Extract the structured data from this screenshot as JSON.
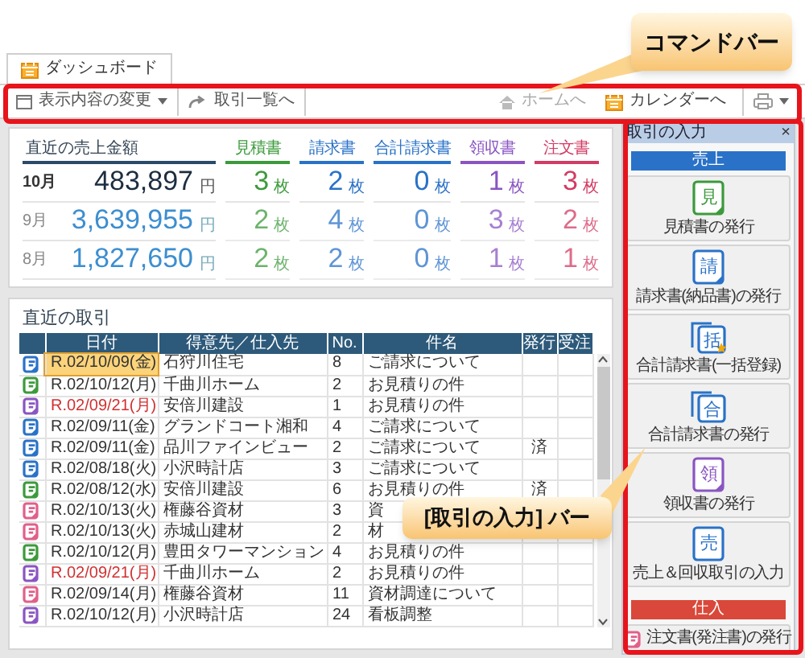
{
  "tab": {
    "label": "ダッシュボード",
    "selected": true
  },
  "command_bar": {
    "left": [
      {
        "label": "表示内容の変更",
        "kind": "view"
      },
      {
        "label": "取引一覧へ",
        "kind": "list"
      }
    ],
    "right": [
      {
        "label": "ホームへ",
        "kind": "home",
        "disabled": true
      },
      {
        "label": "カレンダーへ",
        "kind": "calendar",
        "disabled": false
      },
      {
        "kind": "print"
      }
    ]
  },
  "sales_summary": {
    "title": "直近の売上金額",
    "columns": [
      {
        "label": "見積書",
        "color": "#3c9a3c"
      },
      {
        "label": "請求書",
        "color": "#2a72c8"
      },
      {
        "label": "合計請求書",
        "color": "#2a72c8"
      },
      {
        "label": "領収書",
        "color": "#8a55c2"
      },
      {
        "label": "注文書",
        "color": "#d23c64"
      }
    ],
    "rows": [
      {
        "month": "10月",
        "amount": "483,897",
        "unit": "円",
        "current": true,
        "counts": [
          {
            "value": "3",
            "unit": "枚"
          },
          {
            "value": "2",
            "unit": "枚"
          },
          {
            "value": "0",
            "unit": "枚"
          },
          {
            "value": "1",
            "unit": "枚"
          },
          {
            "value": "3",
            "unit": "枚"
          }
        ]
      },
      {
        "month": "9月",
        "amount": "3,639,955",
        "unit": "円",
        "current": false,
        "counts": [
          {
            "value": "2",
            "unit": "枚"
          },
          {
            "value": "4",
            "unit": "枚"
          },
          {
            "value": "0",
            "unit": "枚"
          },
          {
            "value": "3",
            "unit": "枚"
          },
          {
            "value": "2",
            "unit": "枚"
          }
        ]
      },
      {
        "month": "8月",
        "amount": "1,827,650",
        "unit": "円",
        "current": false,
        "counts": [
          {
            "value": "2",
            "unit": "枚"
          },
          {
            "value": "2",
            "unit": "枚"
          },
          {
            "value": "0",
            "unit": "枚"
          },
          {
            "value": "1",
            "unit": "枚"
          },
          {
            "value": "1",
            "unit": "枚"
          }
        ]
      }
    ]
  },
  "transactions": {
    "title": "直近の取引",
    "columns": [
      "日付",
      "得意先／仕入先",
      "No.",
      "件名",
      "発行",
      "受注"
    ],
    "rows": [
      {
        "kind": "invoice",
        "date": "R.02/10/09(金)",
        "date_alert": false,
        "selected": true,
        "customer": "石狩川住宅",
        "no": "8",
        "subject": "ご請求について"
      },
      {
        "kind": "estimate",
        "date": "R.02/10/12(月)",
        "date_alert": false,
        "selected": false,
        "customer": "千曲川ホーム",
        "no": "2",
        "subject": "お見積りの件"
      },
      {
        "kind": "receipt",
        "date": "R.02/09/21(月)",
        "date_alert": true,
        "selected": false,
        "customer": "安倍川建設",
        "no": "1",
        "subject": "お見積りの件"
      },
      {
        "kind": "invoice",
        "date": "R.02/09/11(金)",
        "date_alert": false,
        "selected": false,
        "customer": "グランドコート湘和",
        "no": "4",
        "subject": "ご請求について"
      },
      {
        "kind": "invoice",
        "date": "R.02/09/11(金)",
        "date_alert": false,
        "selected": false,
        "customer": "品川ファインビュー",
        "no": "2",
        "subject": "ご請求について",
        "issued": "済"
      },
      {
        "kind": "invoice",
        "date": "R.02/08/18(火)",
        "date_alert": false,
        "selected": false,
        "customer": "小沢時計店",
        "no": "3",
        "subject": "ご請求について"
      },
      {
        "kind": "estimate",
        "date": "R.02/08/12(水)",
        "date_alert": false,
        "selected": false,
        "customer": "安倍川建設",
        "no": "6",
        "subject": "お見積りの件",
        "issued": "済"
      },
      {
        "kind": "order",
        "date": "R.02/10/13(火)",
        "date_alert": false,
        "selected": false,
        "customer": "権藤谷資材",
        "no": "3",
        "subject": "資"
      },
      {
        "kind": "order",
        "date": "R.02/10/13(火)",
        "date_alert": false,
        "selected": false,
        "customer": "赤城山建材",
        "no": "2",
        "subject": "材"
      },
      {
        "kind": "estimate",
        "date": "R.02/10/12(月)",
        "date_alert": false,
        "selected": false,
        "customer": "豊田タワーマンション",
        "no": "4",
        "subject": "お見積りの件"
      },
      {
        "kind": "receipt",
        "date": "R.02/09/21(月)",
        "date_alert": true,
        "selected": false,
        "customer": "千曲川ホーム",
        "no": "2",
        "subject": "お見積りの件"
      },
      {
        "kind": "order",
        "date": "R.02/09/14(月)",
        "date_alert": false,
        "selected": false,
        "customer": "権藤谷資材",
        "no": "11",
        "subject": "資材調達について"
      },
      {
        "kind": "receipt",
        "date": "R.02/10/12(月)",
        "date_alert": false,
        "selected": false,
        "customer": "小沢時計店",
        "no": "24",
        "subject": "看板調整"
      }
    ]
  },
  "input_bar": {
    "title": "取引の入力",
    "close": "×",
    "sections": [
      {
        "label": "売上",
        "kind": "sales",
        "buttons": [
          {
            "label": "見積書の発行",
            "glyph": "見",
            "kind": "estimate"
          },
          {
            "label": "請求書(納品書)の発行",
            "glyph": "請",
            "kind": "invoice"
          },
          {
            "label": "合計請求書(一括登録)",
            "glyph": "括",
            "kind": "bulk"
          },
          {
            "label": "合計請求書の発行",
            "glyph": "合",
            "kind": "total"
          },
          {
            "label": "領収書の発行",
            "glyph": "領",
            "kind": "receipt"
          },
          {
            "label": "売上＆回収取引の入力",
            "glyph": "売",
            "kind": "sales"
          }
        ]
      },
      {
        "label": "仕入",
        "kind": "purchase",
        "buttons": [
          {
            "label": "注文書(発注書)の発行",
            "kind": "order"
          }
        ]
      }
    ]
  },
  "callouts": [
    {
      "text": "コマンドバー",
      "kind": "command"
    },
    {
      "text": "[取引の入力] バー",
      "kind": "input"
    }
  ]
}
